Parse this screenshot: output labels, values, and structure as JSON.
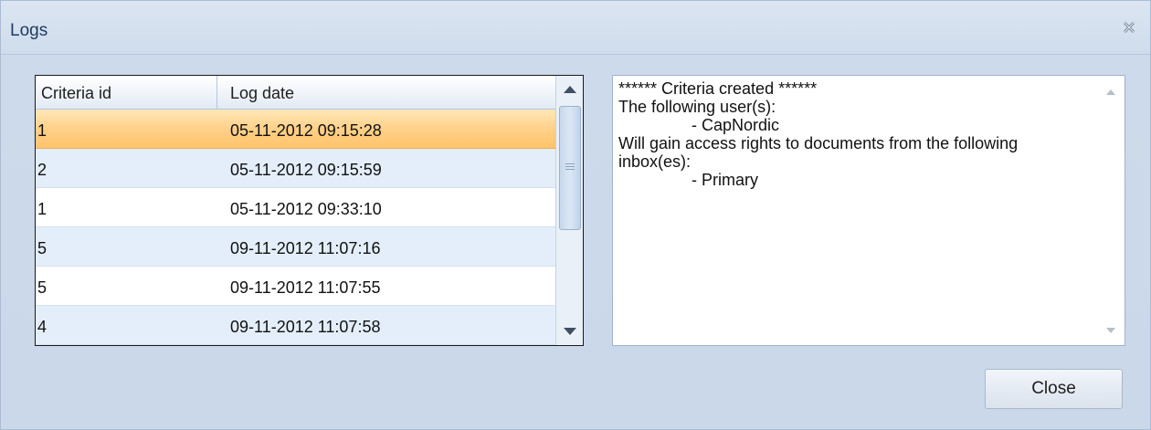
{
  "window": {
    "title": "Logs",
    "close_icon": "close-x-icon"
  },
  "grid": {
    "columns": [
      "Criteria id",
      "Log date"
    ],
    "rows": [
      {
        "criteria_id": "1",
        "log_date": "05-11-2012 09:15:28",
        "selected": true
      },
      {
        "criteria_id": "2",
        "log_date": "05-11-2012 09:15:59"
      },
      {
        "criteria_id": "1",
        "log_date": "05-11-2012 09:33:10"
      },
      {
        "criteria_id": "5",
        "log_date": "09-11-2012 11:07:16"
      },
      {
        "criteria_id": "5",
        "log_date": "09-11-2012 11:07:55"
      },
      {
        "criteria_id": "4",
        "log_date": "09-11-2012 11:07:58"
      }
    ]
  },
  "details": {
    "text": "****** Criteria created ******\nThe following user(s):\n\t\t- CapNordic\nWill gain access rights to documents from the following inbox(es):\n\t\t- Primary"
  },
  "buttons": {
    "close_label": "Close"
  },
  "colors": {
    "selection": "#ffd18a",
    "alt_row": "#e3eefa",
    "window_bg": "#cfdcec"
  }
}
